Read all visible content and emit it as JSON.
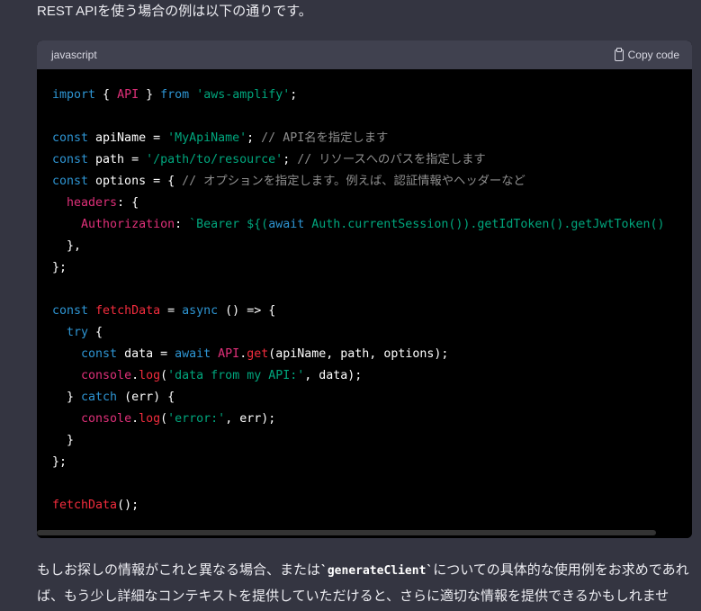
{
  "message": {
    "intro": "REST APIを使う場合の例は以下の通りです。",
    "outro_before": "もしお探しの情報がこれと異なる場合、または",
    "outro_code": "`generateClient`",
    "outro_after": "についての具体的な使用例をお求めであれば、もう少し詳細なコンテキストを提供していただけると、さらに適切な情報を提供できるかもしれません。"
  },
  "code_block": {
    "language": "javascript",
    "copy_label": "Copy code",
    "lines": [
      [
        {
          "t": "import",
          "c": "kw"
        },
        {
          "t": " { "
        },
        {
          "t": "API",
          "c": "prop"
        },
        {
          "t": " } "
        },
        {
          "t": "from",
          "c": "kw"
        },
        {
          "t": " "
        },
        {
          "t": "'aws-amplify'",
          "c": "str"
        },
        {
          "t": ";"
        }
      ],
      [],
      [
        {
          "t": "const",
          "c": "kw"
        },
        {
          "t": " apiName = "
        },
        {
          "t": "'MyApiName'",
          "c": "str"
        },
        {
          "t": "; "
        },
        {
          "t": "// API名を指定します",
          "c": "cm"
        }
      ],
      [
        {
          "t": "const",
          "c": "kw"
        },
        {
          "t": " path = "
        },
        {
          "t": "'/path/to/resource'",
          "c": "str"
        },
        {
          "t": "; "
        },
        {
          "t": "// リソースへのパスを指定します",
          "c": "cm"
        }
      ],
      [
        {
          "t": "const",
          "c": "kw"
        },
        {
          "t": " options = { "
        },
        {
          "t": "// オプションを指定します。例えば、認証情報やヘッダーなど",
          "c": "cm"
        }
      ],
      [
        {
          "t": "  "
        },
        {
          "t": "headers",
          "c": "prop"
        },
        {
          "t": ": {"
        }
      ],
      [
        {
          "t": "    "
        },
        {
          "t": "Authorization",
          "c": "prop"
        },
        {
          "t": ": "
        },
        {
          "t": "`Bearer ${(",
          "c": "str"
        },
        {
          "t": "await",
          "c": "kw"
        },
        {
          "t": " Auth.currentSession()).getIdToken().getJwtToken()",
          "c": "str"
        }
      ],
      [
        {
          "t": "  },"
        }
      ],
      [
        {
          "t": "};"
        }
      ],
      [],
      [
        {
          "t": "const",
          "c": "kw"
        },
        {
          "t": " "
        },
        {
          "t": "fetchData",
          "c": "fn"
        },
        {
          "t": " = "
        },
        {
          "t": "async",
          "c": "kw"
        },
        {
          "t": " () => {"
        }
      ],
      [
        {
          "t": "  "
        },
        {
          "t": "try",
          "c": "kw"
        },
        {
          "t": " {"
        }
      ],
      [
        {
          "t": "    "
        },
        {
          "t": "const",
          "c": "kw"
        },
        {
          "t": " data = "
        },
        {
          "t": "await",
          "c": "kw"
        },
        {
          "t": " "
        },
        {
          "t": "API",
          "c": "prop"
        },
        {
          "t": "."
        },
        {
          "t": "get",
          "c": "fn"
        },
        {
          "t": "(apiName, path, options);"
        }
      ],
      [
        {
          "t": "    "
        },
        {
          "t": "console",
          "c": "prop"
        },
        {
          "t": "."
        },
        {
          "t": "log",
          "c": "fn"
        },
        {
          "t": "("
        },
        {
          "t": "'data from my API:'",
          "c": "str"
        },
        {
          "t": ", data);"
        }
      ],
      [
        {
          "t": "  } "
        },
        {
          "t": "catch",
          "c": "kw"
        },
        {
          "t": " (err) {"
        }
      ],
      [
        {
          "t": "    "
        },
        {
          "t": "console",
          "c": "prop"
        },
        {
          "t": "."
        },
        {
          "t": "log",
          "c": "fn"
        },
        {
          "t": "("
        },
        {
          "t": "'error:'",
          "c": "str"
        },
        {
          "t": ", err);"
        }
      ],
      [
        {
          "t": "  }"
        }
      ],
      [
        {
          "t": "};"
        }
      ],
      [],
      [
        {
          "t": "fetchData",
          "c": "fn"
        },
        {
          "t": "();"
        }
      ]
    ]
  },
  "colors": {
    "page_background": "#343541",
    "code_background": "#000000",
    "keyword": "#2e95d3",
    "string": "#00a67d",
    "function": "#f22c3d",
    "property": "#df3079",
    "comment": "#8e8e8e"
  }
}
